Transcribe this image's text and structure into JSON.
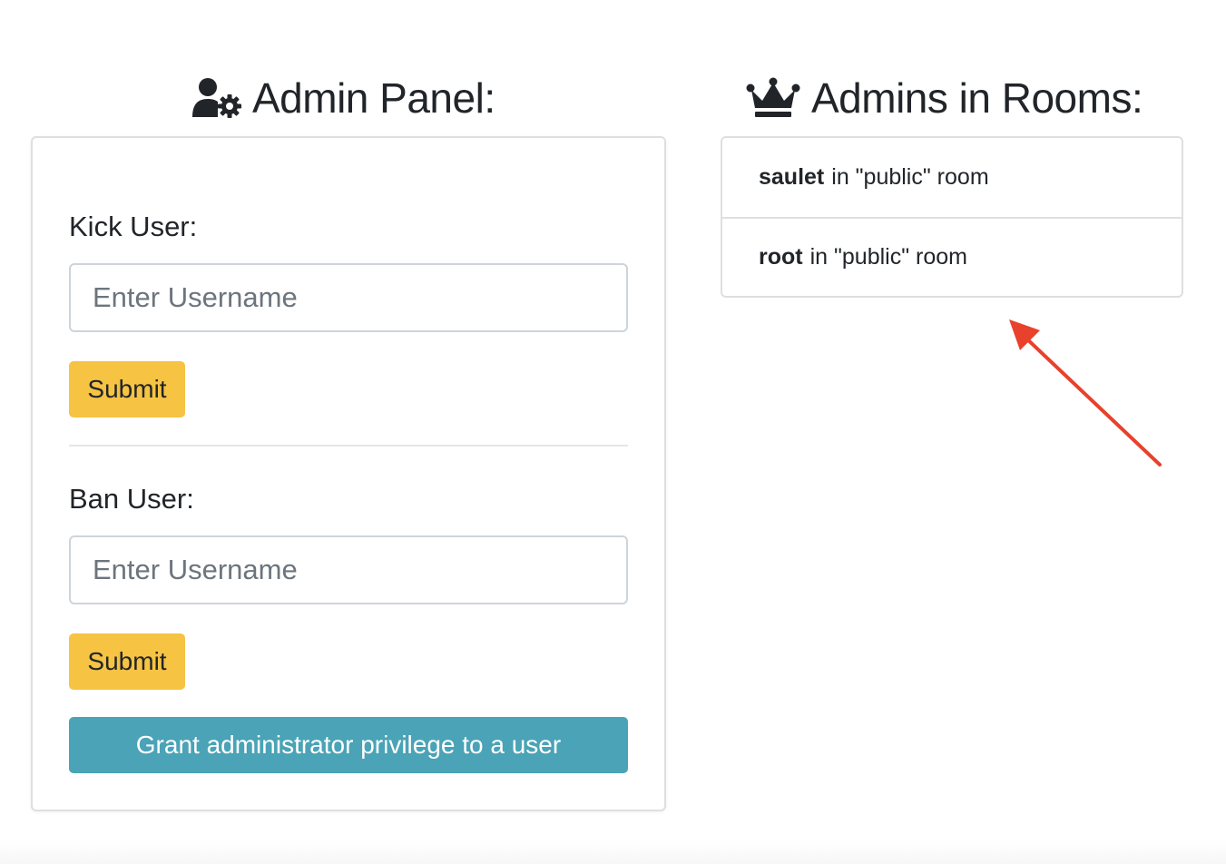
{
  "admin_panel": {
    "title": "Admin Panel:",
    "icon": "user-cog-icon",
    "kick": {
      "label": "Kick User:",
      "placeholder": "Enter Username",
      "submit_label": "Submit"
    },
    "ban": {
      "label": "Ban User:",
      "placeholder": "Enter Username",
      "submit_label": "Submit"
    },
    "grant_label": "Grant administrator privilege to a user"
  },
  "admins_in_rooms": {
    "title": "Admins in Rooms:",
    "icon": "crown-icon",
    "items": [
      {
        "username": "saulet",
        "suffix": "in \"public\" room"
      },
      {
        "username": "root",
        "suffix": "in \"public\" room"
      }
    ]
  },
  "colors": {
    "warning": "#f6c343",
    "info": "#4aa3b6",
    "annotation_arrow": "#e8412c"
  }
}
